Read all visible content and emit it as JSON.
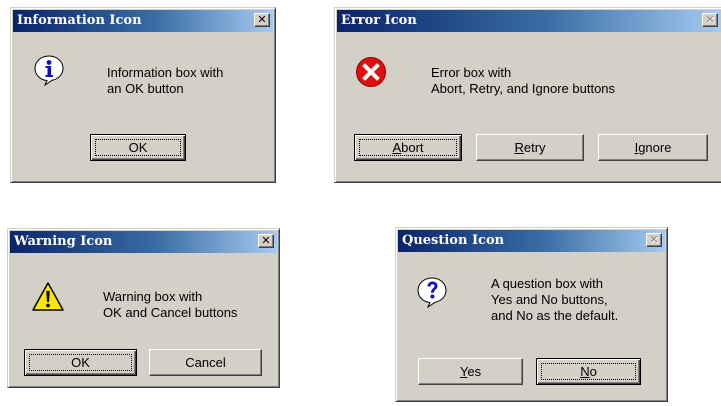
{
  "dialogs": {
    "information": {
      "title": "Information Icon",
      "icon": "information-icon",
      "message": "Information box with\nan OK button",
      "buttons": {
        "ok": "OK"
      }
    },
    "error": {
      "title": "Error Icon",
      "icon": "error-icon",
      "message": "Error box with\nAbort, Retry, and Ignore buttons",
      "buttons": {
        "abort": {
          "accel": "A",
          "rest": "bort"
        },
        "retry": {
          "accel": "R",
          "rest": "etry"
        },
        "ignore": {
          "accel": "I",
          "rest": "gnore"
        }
      }
    },
    "warning": {
      "title": "Warning Icon",
      "icon": "warning-icon",
      "message": "Warning box with\nOK and Cancel buttons",
      "buttons": {
        "ok": "OK",
        "cancel": "Cancel"
      }
    },
    "question": {
      "title": "Question Icon",
      "icon": "question-icon",
      "message": "A question box with\nYes and No buttons,\nand No as the default.",
      "buttons": {
        "yes": {
          "accel": "Y",
          "rest": "es"
        },
        "no": {
          "accel": "N",
          "rest": "o"
        }
      }
    }
  },
  "close_glyph": "✕",
  "colors": {
    "dialog_face": "#d4d0c8",
    "title_active_start": "#0a246a",
    "title_active_end": "#a6caf0",
    "error_red": "#e01010",
    "warning_yellow": "#ffe800",
    "info_blue": "#1010c0"
  }
}
